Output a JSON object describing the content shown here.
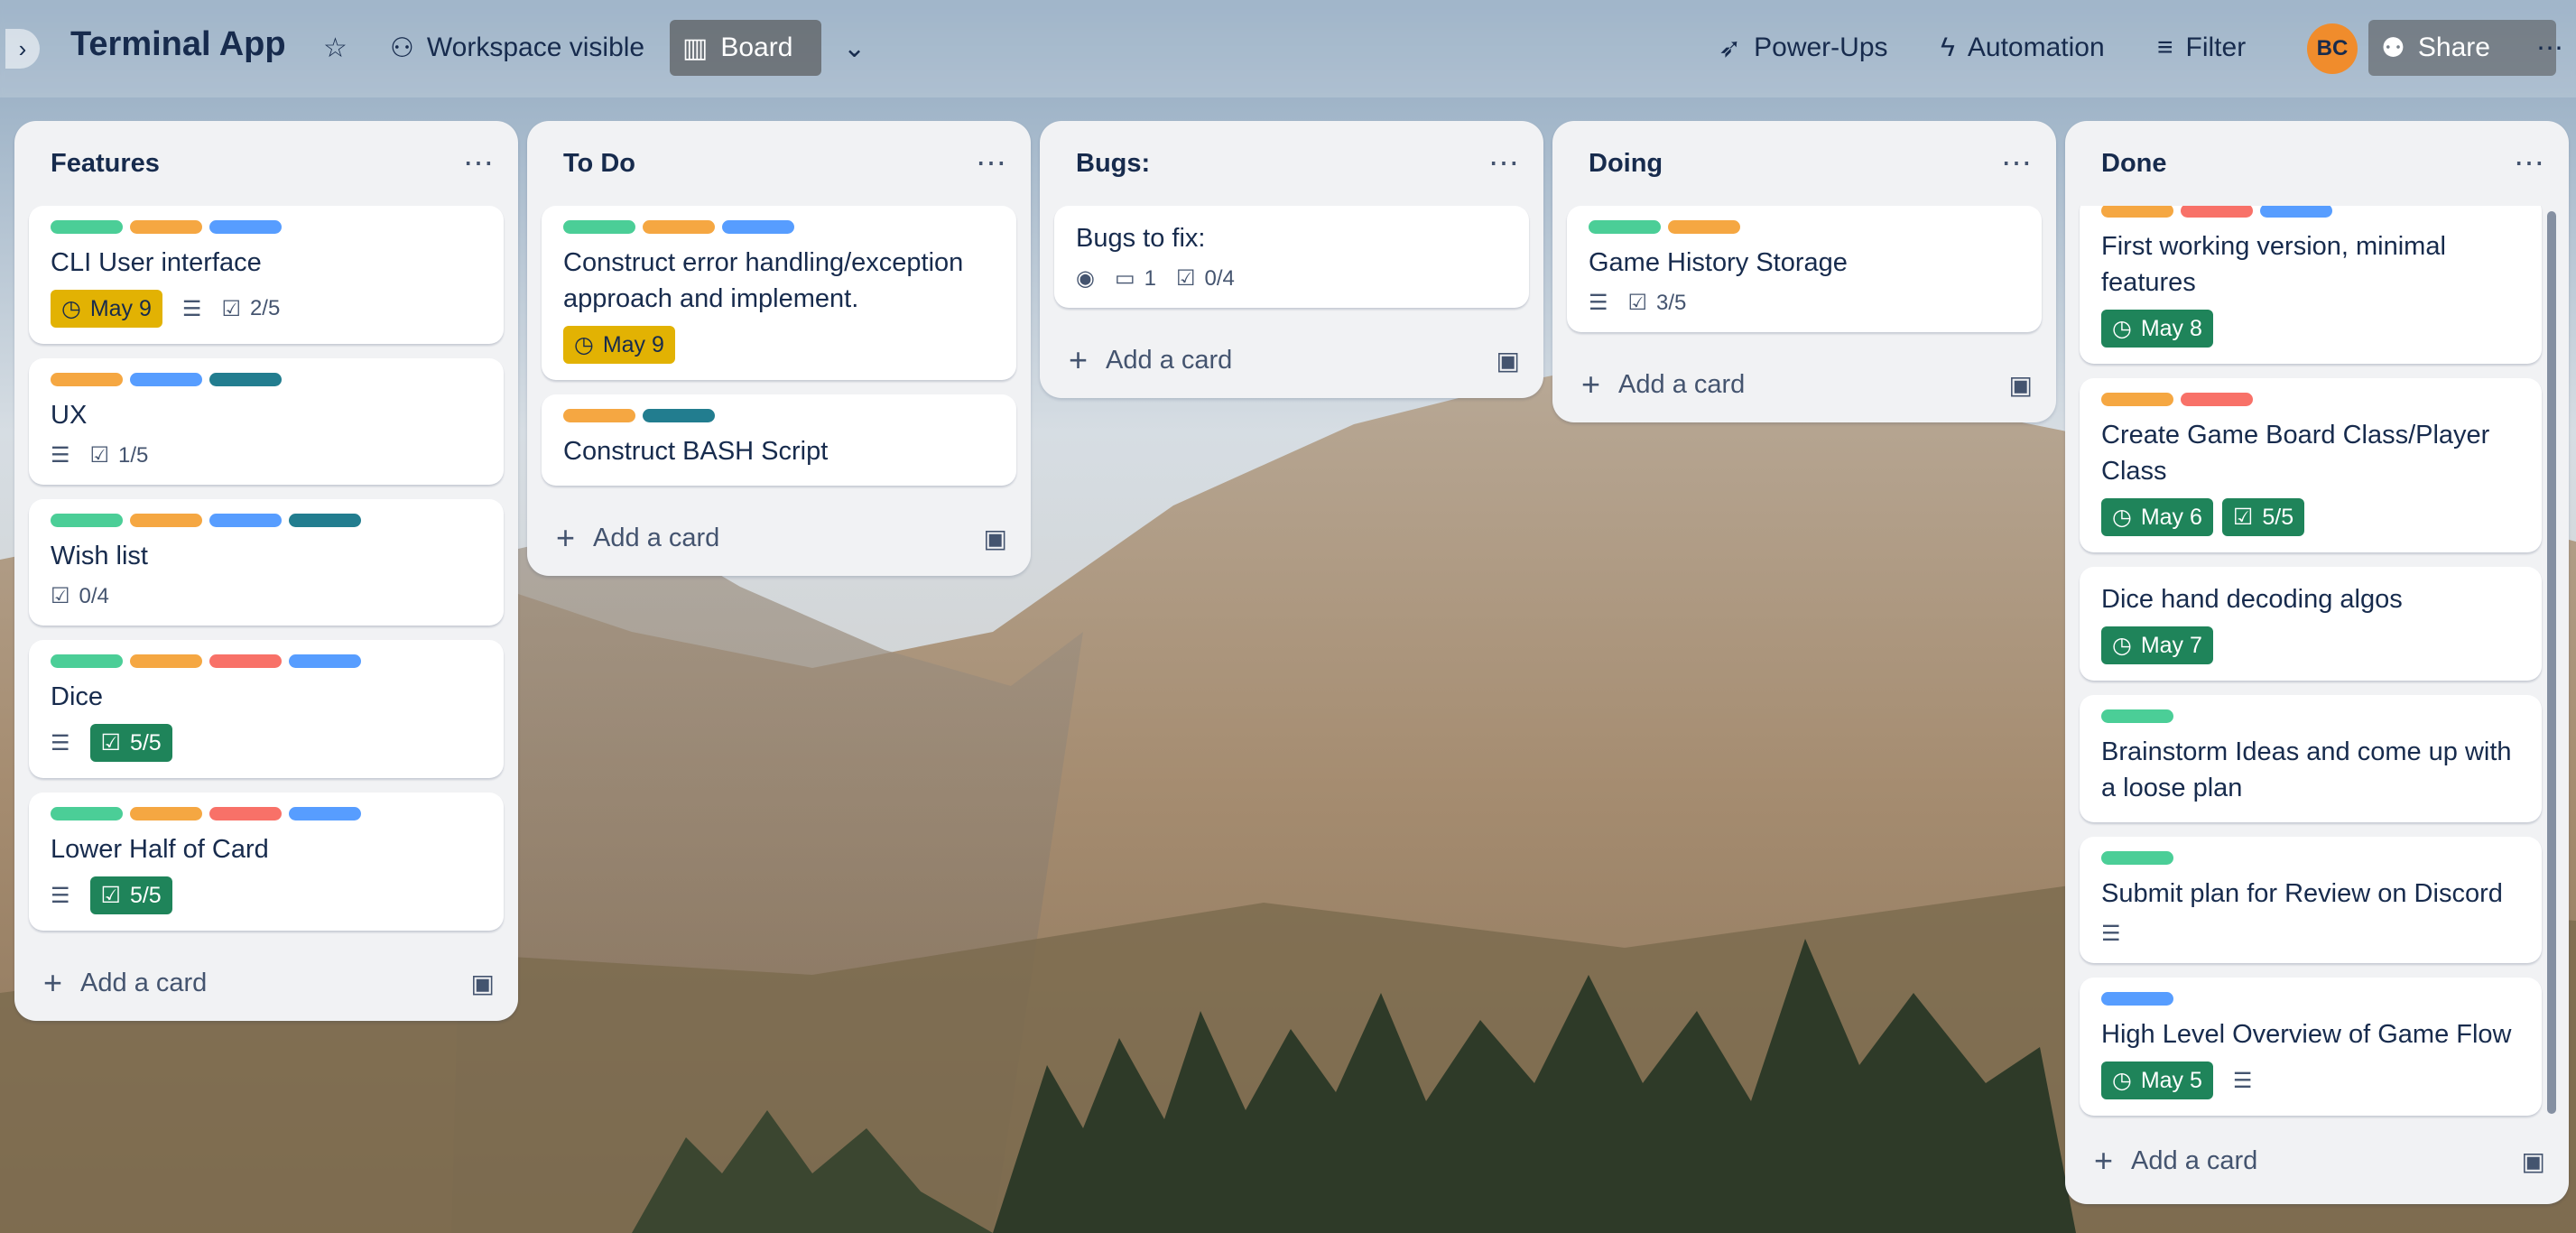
{
  "header": {
    "title": "Terminal App",
    "workspace_visible": "Workspace visible",
    "board": "Board",
    "power_ups": "Power-Ups",
    "automation": "Automation",
    "filter": "Filter",
    "avatar_initials": "BC",
    "share": "Share"
  },
  "lists": [
    {
      "title": "Features",
      "add_card": "Add a card",
      "cards": [
        {
          "title": "CLI User interface",
          "due": "May 9",
          "checklist": "2/5"
        },
        {
          "title": "UX",
          "checklist": "1/5"
        },
        {
          "title": "Wish list",
          "checklist": "0/4"
        },
        {
          "title": "Dice",
          "checklist": "5/5"
        },
        {
          "title": "Lower Half of Card",
          "checklist": "5/5"
        }
      ]
    },
    {
      "title": "To Do",
      "add_card": "Add a card",
      "cards": [
        {
          "title": "Construct error handling/exception approach and implement.",
          "due": "May 9"
        },
        {
          "title": "Construct BASH Script"
        }
      ]
    },
    {
      "title": "Bugs:",
      "add_card": "Add a card",
      "cards": [
        {
          "title": "Bugs to fix:",
          "comments": "1",
          "checklist": "0/4"
        }
      ]
    },
    {
      "title": "Doing",
      "add_card": "Add a card",
      "cards": [
        {
          "title": "Game History Storage",
          "checklist": "3/5"
        }
      ]
    },
    {
      "title": "Done",
      "add_card": "Add a card",
      "cards": [
        {
          "title": "First working version, minimal features",
          "due": "May 8"
        },
        {
          "title": "Create Game Board Class/Player Class",
          "due": "May 6",
          "checklist": "5/5"
        },
        {
          "title": "Dice hand decoding algos",
          "due": "May 7"
        },
        {
          "title": "Brainstorm Ideas and come up with a loose plan"
        },
        {
          "title": "Submit plan for Review on Discord"
        },
        {
          "title": "High Level Overview of Game Flow",
          "due": "May 5"
        }
      ]
    }
  ],
  "colors": {
    "green": "#4bce97",
    "orange": "#f5a742",
    "blue": "#579dff",
    "teal": "#227d8f",
    "red": "#f87168",
    "due_yellow": "#e2b203",
    "complete_green": "#1f845a"
  }
}
